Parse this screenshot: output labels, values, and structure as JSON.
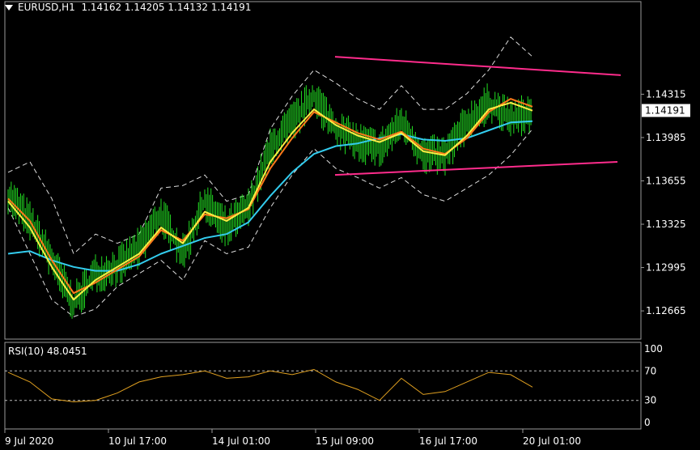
{
  "header": {
    "symbol": "EURUSD,H1",
    "open": "1.14162",
    "high": "1.14205",
    "low": "1.14132",
    "close": "1.14191"
  },
  "rsi_header": {
    "label": "RSI(10)",
    "value": "48.0451"
  },
  "colors": {
    "background": "#000000",
    "candles": "#22dd22",
    "ma_fast": "#ffee44",
    "ma_mid": "#ff7a1a",
    "ma_slow": "#33ccee",
    "bands": "#dddddd",
    "trendlines": "#ff2c8c",
    "rsi": "#e0a020",
    "price_tag_bg": "#ffffff"
  },
  "chart_data": [
    {
      "type": "line",
      "x": [
        "9 Jul 2020",
        "10 Jul 17:00",
        "14 Jul 01:00",
        "15 Jul 09:00",
        "16 Jul 17:00",
        "20 Jul 01:00"
      ],
      "y_ticks": [
        "1.14315",
        "1.13985",
        "1.13655",
        "1.13325",
        "1.12995",
        "1.12665"
      ],
      "ylim": [
        1.1245,
        1.1502
      ],
      "current_price": "1.14191",
      "series": [
        {
          "role": "close",
          "values": [
            1.1355,
            1.1335,
            1.1305,
            1.1272,
            1.1295,
            1.13,
            1.1315,
            1.134,
            1.131,
            1.135,
            1.133,
            1.1345,
            1.139,
            1.141,
            1.143,
            1.1405,
            1.1395,
            1.139,
            1.141,
            1.1385,
            1.1385,
            1.141,
            1.1425,
            1.1412,
            1.1419
          ]
        },
        {
          "role": "ma_fast",
          "values": [
            1.135,
            1.133,
            1.13,
            1.1275,
            1.129,
            1.13,
            1.131,
            1.133,
            1.1318,
            1.1342,
            1.1335,
            1.1345,
            1.138,
            1.1402,
            1.142,
            1.1408,
            1.14,
            1.1395,
            1.1402,
            1.1388,
            1.1385,
            1.14,
            1.142,
            1.1425,
            1.1419
          ]
        },
        {
          "role": "ma_mid",
          "values": [
            1.1352,
            1.1335,
            1.1305,
            1.128,
            1.1288,
            1.1298,
            1.1308,
            1.1328,
            1.132,
            1.134,
            1.1337,
            1.1344,
            1.1375,
            1.1398,
            1.1418,
            1.141,
            1.1402,
            1.1397,
            1.1403,
            1.139,
            1.1386,
            1.1398,
            1.1418,
            1.1428,
            1.1422
          ]
        },
        {
          "role": "ma_slow",
          "values": [
            1.131,
            1.1312,
            1.1305,
            1.13,
            1.1297,
            1.1297,
            1.1302,
            1.131,
            1.1316,
            1.1322,
            1.1325,
            1.1334,
            1.1354,
            1.1372,
            1.1386,
            1.1392,
            1.1394,
            1.1398,
            1.1401,
            1.1397,
            1.1396,
            1.1398,
            1.1404,
            1.141,
            1.1411
          ]
        },
        {
          "role": "band_upper",
          "values": [
            1.1372,
            1.138,
            1.1352,
            1.131,
            1.1325,
            1.1318,
            1.1325,
            1.136,
            1.1362,
            1.137,
            1.135,
            1.1355,
            1.1405,
            1.143,
            1.145,
            1.144,
            1.1428,
            1.142,
            1.1438,
            1.142,
            1.142,
            1.1432,
            1.145,
            1.1475,
            1.146
          ]
        },
        {
          "role": "band_lower",
          "values": [
            1.1345,
            1.131,
            1.1275,
            1.1262,
            1.1268,
            1.1285,
            1.1295,
            1.1305,
            1.129,
            1.132,
            1.131,
            1.1315,
            1.1345,
            1.137,
            1.139,
            1.1375,
            1.1368,
            1.136,
            1.1368,
            1.1355,
            1.135,
            1.136,
            1.137,
            1.1385,
            1.1405
          ]
        },
        {
          "role": "trend_upper",
          "values": [
            1.146,
            1.1446
          ]
        },
        {
          "role": "trend_lower",
          "values": [
            1.137,
            1.138
          ]
        }
      ]
    },
    {
      "type": "line",
      "y_ticks": [
        "100",
        "70",
        "30",
        "0"
      ],
      "ylim": [
        0,
        100
      ],
      "levels": [
        70,
        30
      ],
      "series": [
        {
          "role": "rsi",
          "values": [
            68,
            55,
            32,
            28,
            30,
            40,
            55,
            62,
            65,
            70,
            60,
            62,
            70,
            65,
            72,
            55,
            45,
            30,
            60,
            38,
            42,
            55,
            68,
            65,
            48
          ]
        }
      ]
    }
  ]
}
